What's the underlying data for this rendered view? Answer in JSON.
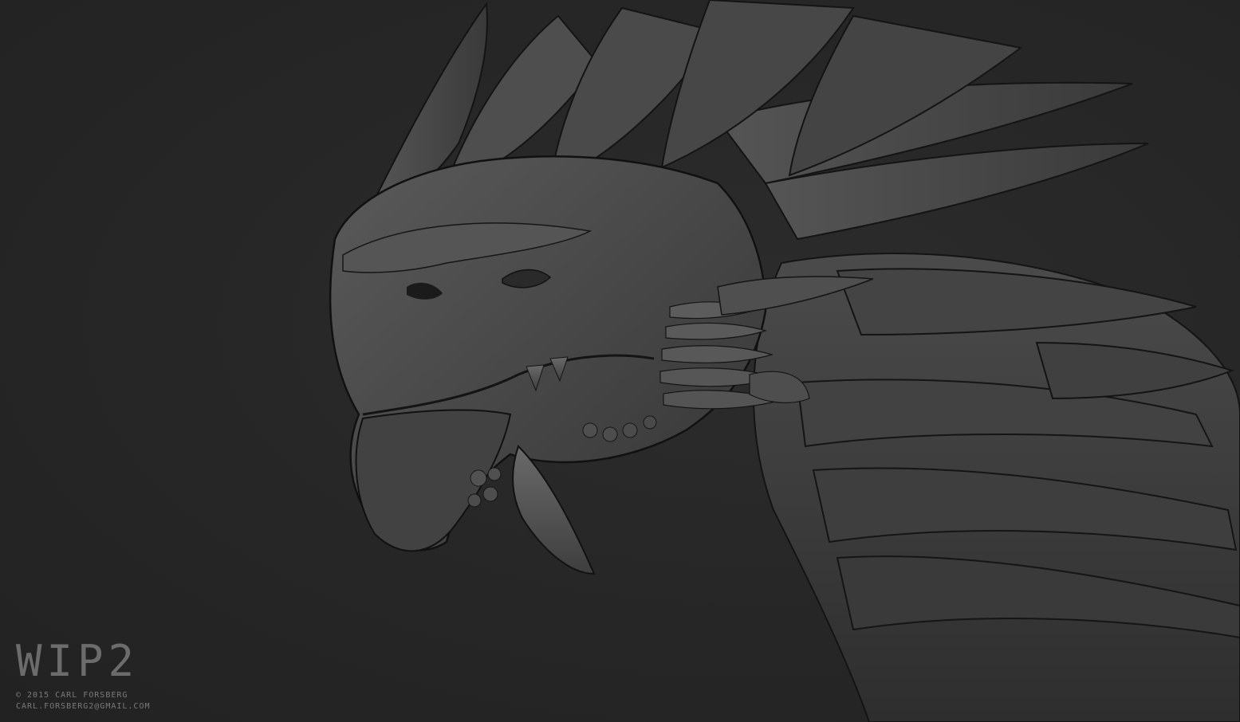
{
  "watermark": {
    "title": "WIP2",
    "copyright": "© 2015 CARL FORSBERG",
    "email": "CARL.FORSBERG2@GMAIL.COM"
  },
  "colors": {
    "background": "#262626",
    "sculpt_base": "#4a4a4a",
    "sculpt_shadow": "#1c1c1c",
    "sculpt_highlight": "#6a6a6a",
    "caption_text": "#6f6f6f"
  },
  "image": {
    "subject": "dragon-head-sculpt"
  }
}
